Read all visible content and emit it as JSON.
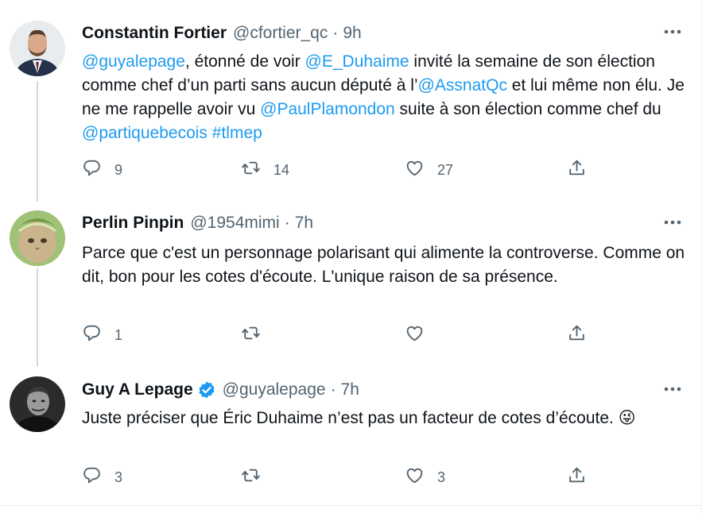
{
  "tweets": [
    {
      "name": "Constantin Fortier",
      "handle": "@cfortier_qc",
      "time": "9h",
      "verified": false,
      "body": [
        {
          "t": "@guyalepage",
          "m": true
        },
        {
          "t": ", étonné de voir ",
          "m": false
        },
        {
          "t": "@E_Duhaime",
          "m": true
        },
        {
          "t": " invité la semaine de son élection comme chef d’un parti sans aucun député à l’",
          "m": false
        },
        {
          "t": "@AssnatQc",
          "m": true
        },
        {
          "t": " et lui même non élu. Je ne me rappelle avoir vu ",
          "m": false
        },
        {
          "t": "@PaulPlamondon",
          "m": true
        },
        {
          "t": " suite à son élection comme chef du ",
          "m": false
        },
        {
          "t": "@partiquebecois",
          "m": true
        },
        {
          "t": " ",
          "m": false
        },
        {
          "t": "#tlmep",
          "m": true
        }
      ],
      "replies": "9",
      "retweets": "14",
      "likes": "27"
    },
    {
      "name": "Perlin Pinpin",
      "handle": "@1954mimi",
      "time": "7h",
      "verified": false,
      "body": [
        {
          "t": "Parce que c'est un personnage polarisant qui alimente la controverse. Comme on dit, bon pour les cotes d'écoute. L'unique raison de sa présence.",
          "m": false
        }
      ],
      "replies": "1",
      "retweets": "",
      "likes": ""
    },
    {
      "name": "Guy A Lepage",
      "handle": "@guyalepage",
      "time": "7h",
      "verified": true,
      "body": [
        {
          "t": "Juste préciser que Éric Duhaime n’est pas un facteur de cotes d’écoute.  ",
          "m": false
        },
        {
          "t": "😜",
          "m": false
        }
      ],
      "replies": "3",
      "retweets": "",
      "likes": "3"
    }
  ],
  "separator": " · ",
  "colors": {
    "accent": "#1d9bf0",
    "muted": "#536471",
    "text": "#0f1419",
    "thread": "#cfd9de"
  },
  "icons": [
    "reply-icon",
    "retweet-icon",
    "like-icon",
    "share-icon",
    "more-icon",
    "verified-badge-icon"
  ]
}
